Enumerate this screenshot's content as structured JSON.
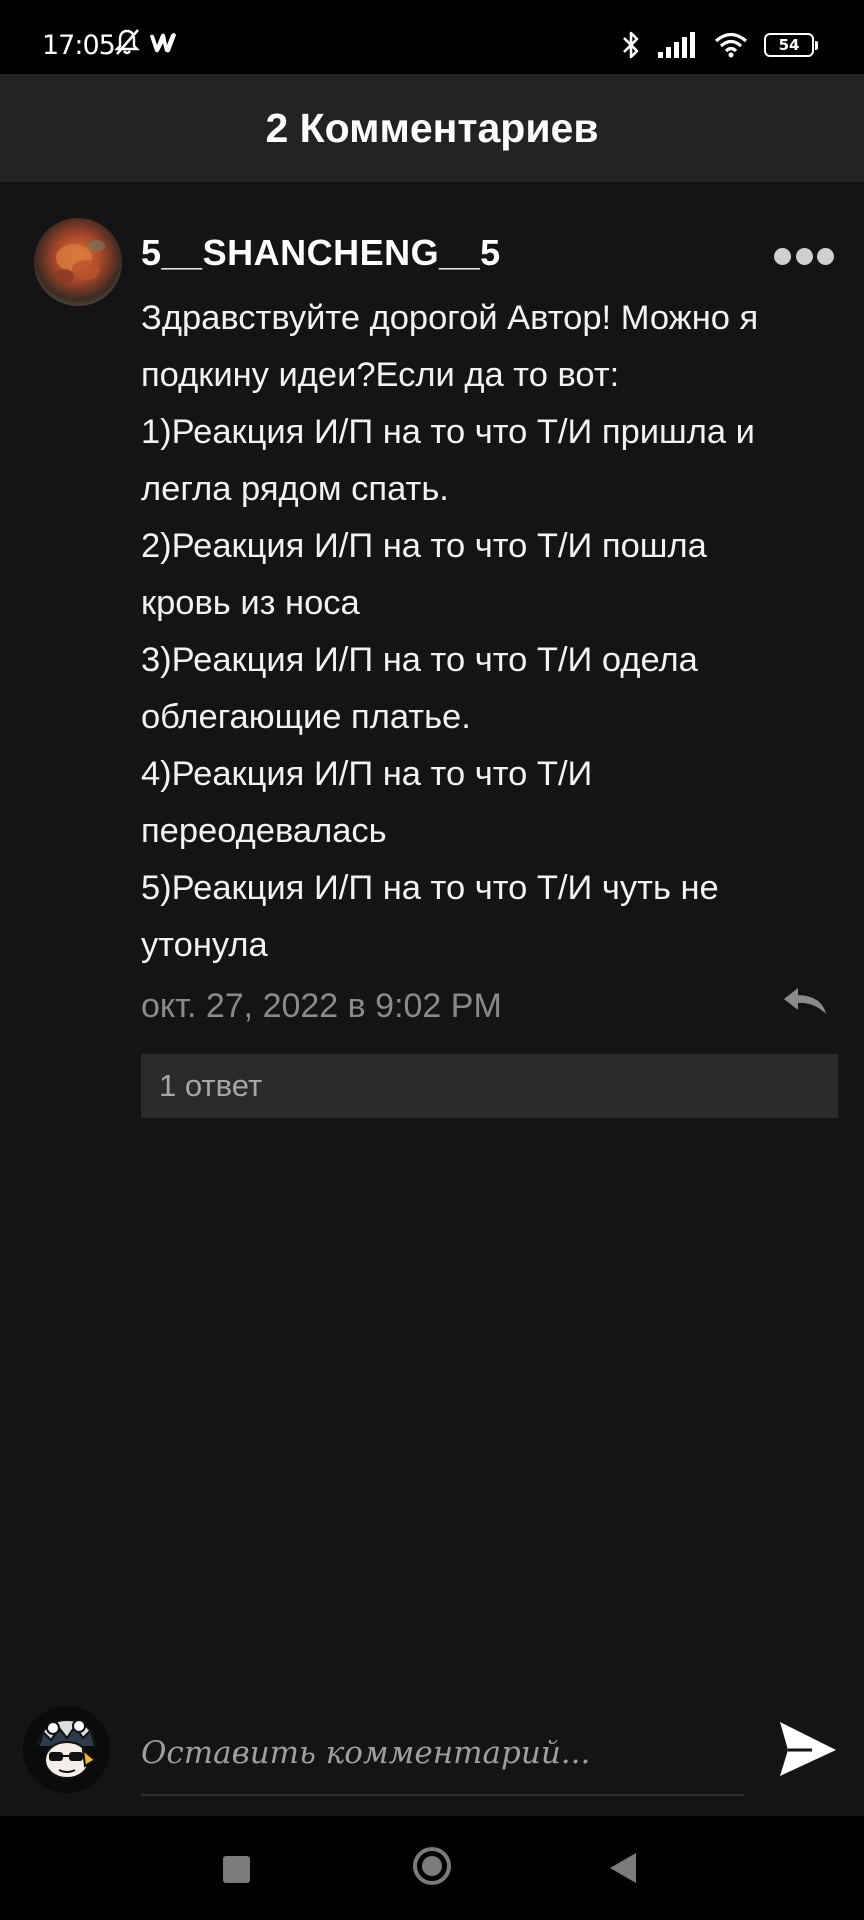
{
  "status_bar": {
    "time": "17:05",
    "battery": "54",
    "icons": [
      "notifications-off-icon",
      "wattpad-icon",
      "bluetooth-icon",
      "signal-icon",
      "wifi-icon",
      "battery-icon"
    ]
  },
  "header": {
    "title": "2 Комментариев"
  },
  "comment": {
    "author": "5__SHANCHENG__5",
    "text": "Здравствуйте дорогой Автор! Можно я\nподкину идеи?Если да то вот:\n1)Реакция И/П на то что Т/И пришла и\nлегла рядом спать.\n2)Реакция И/П на то что Т/И пошла\nкровь из носа\n3)Реакция И/П на то что Т/И одела\nоблегающие платье.\n4)Реакция И/П на то что Т/И\nпереодевалась\n5)Реакция И/П на то что Т/И чуть не\nутонула",
    "date": "окт. 27, 2022 в 9:02 PM",
    "replies_label": "1 ответ"
  },
  "composer": {
    "placeholder": "Оставить комментарий..."
  },
  "colors": {
    "background": "#141315",
    "header_bg": "#232224",
    "muted_text": "#8a898c",
    "reply_box_bg": "#2b2a2d"
  }
}
